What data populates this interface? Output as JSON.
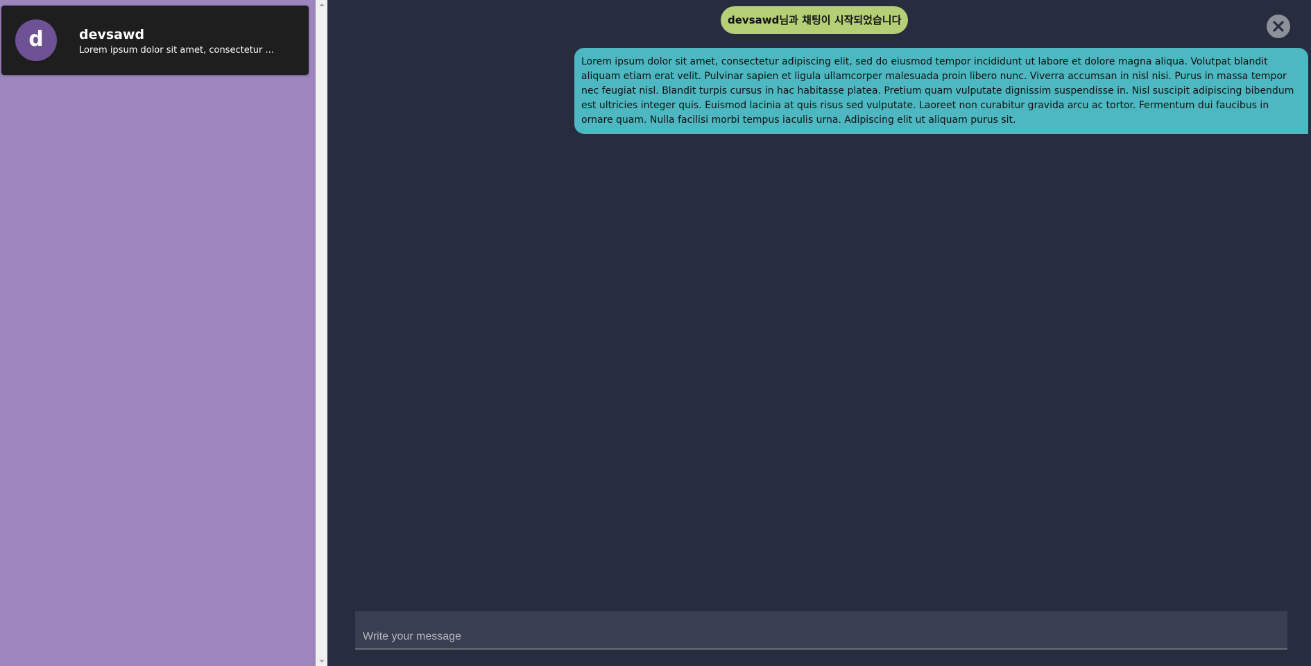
{
  "colors": {
    "sidebar_bg": "#9d85be",
    "chat_bg": "#272c3f",
    "card_bg": "#1e1e1e",
    "avatar_bg": "#6f5195",
    "system_badge_bg": "#b5cf77",
    "message_bubble_bg": "#4db8c1",
    "composer_bg": "#393e50",
    "close_button_bg": "#8d9099"
  },
  "sidebar": {
    "chats": [
      {
        "avatar_letter": "d",
        "name": "devsawd",
        "preview": "Lorem ipsum dolor sit amet, consectetur ..."
      }
    ]
  },
  "chat": {
    "system_message": "devsawd님과 채팅이 시작되었습니다",
    "close_icon": "close-icon",
    "messages": [
      {
        "text": "Lorem ipsum dolor sit amet, consectetur adipiscing elit, sed do eiusmod tempor incididunt ut labore et dolore magna aliqua. Volutpat blandit aliquam etiam erat velit. Pulvinar sapien et ligula ullamcorper malesuada proin libero nunc. Viverra accumsan in nisl nisi. Purus in massa tempor nec feugiat nisl. Blandit turpis cursus in hac habitasse platea. Pretium quam vulputate dignissim suspendisse in. Nisl suscipit adipiscing bibendum est ultricies integer quis. Euismod lacinia at quis risus sed vulputate. Laoreet non curabitur gravida arcu ac tortor. Fermentum dui faucibus in ornare quam. Nulla facilisi morbi tempus iaculis urna. Adipiscing elit ut aliquam purus sit."
      }
    ],
    "composer": {
      "placeholder": "Write your message",
      "value": ""
    }
  }
}
